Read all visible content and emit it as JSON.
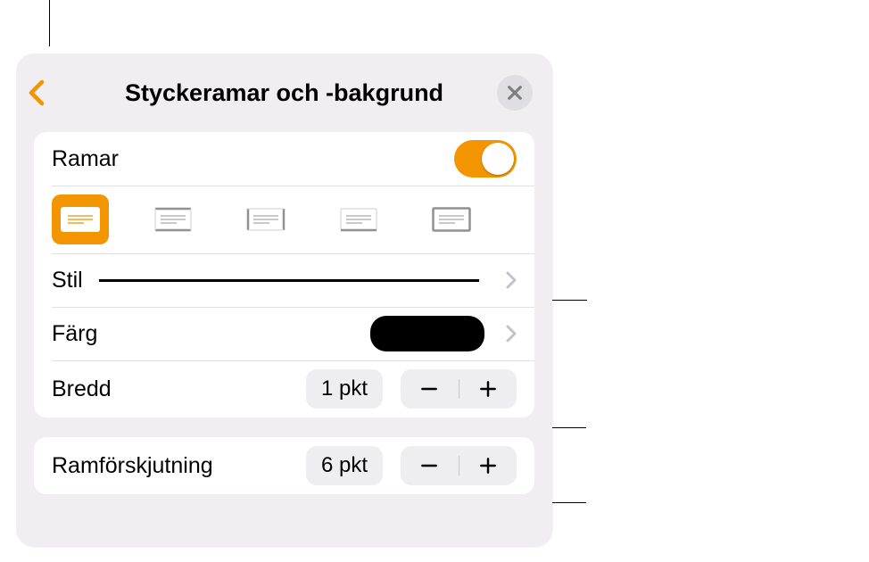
{
  "header": {
    "title": "Styckeramar och -bakgrund"
  },
  "colors": {
    "accent": "#f39500",
    "swatch": "#000000"
  },
  "ramar": {
    "label": "Ramar",
    "on": true
  },
  "positions": [
    {
      "name": "full-box",
      "selected": true
    },
    {
      "name": "top-bottom",
      "selected": false
    },
    {
      "name": "left-right",
      "selected": false
    },
    {
      "name": "bottom-only",
      "selected": false
    },
    {
      "name": "outline",
      "selected": false
    }
  ],
  "stil": {
    "label": "Stil"
  },
  "farg": {
    "label": "Färg"
  },
  "bredd": {
    "label": "Bredd",
    "value": "1 pkt"
  },
  "offset": {
    "label": "Ramförskjutning",
    "value": "6 pkt"
  }
}
